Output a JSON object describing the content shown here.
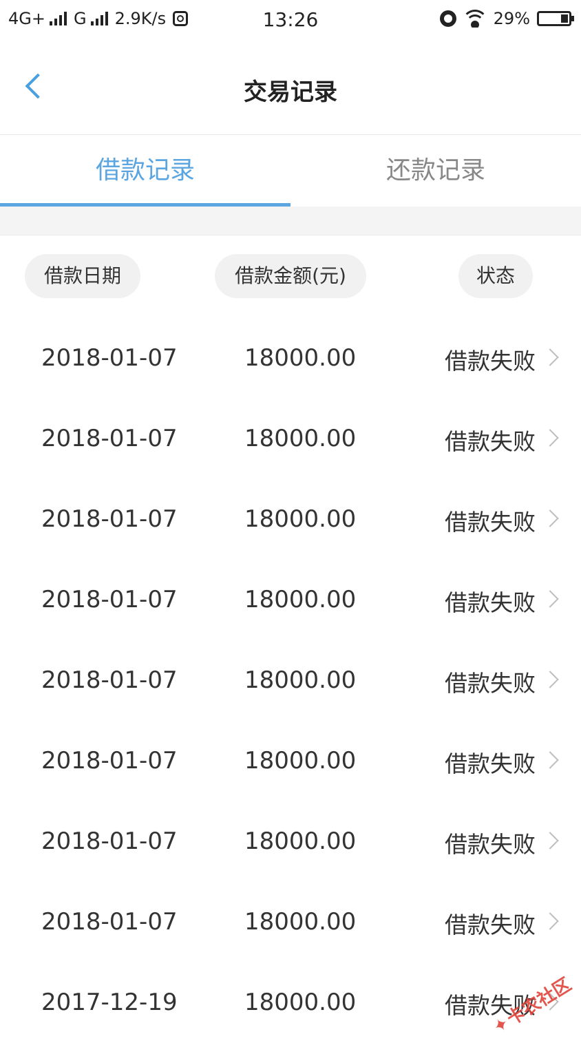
{
  "status_bar": {
    "network1": "4G+",
    "network2": "G",
    "speed": "2.9K/s",
    "time": "13:26",
    "battery": "29%"
  },
  "nav": {
    "title": "交易记录"
  },
  "tabs": [
    {
      "label": "借款记录",
      "active": true
    },
    {
      "label": "还款记录",
      "active": false
    }
  ],
  "table": {
    "headers": {
      "date": "借款日期",
      "amount": "借款金额(元)",
      "status": "状态"
    },
    "rows": [
      {
        "date": "2018-01-07",
        "amount": "18000.00",
        "status": "借款失败"
      },
      {
        "date": "2018-01-07",
        "amount": "18000.00",
        "status": "借款失败"
      },
      {
        "date": "2018-01-07",
        "amount": "18000.00",
        "status": "借款失败"
      },
      {
        "date": "2018-01-07",
        "amount": "18000.00",
        "status": "借款失败"
      },
      {
        "date": "2018-01-07",
        "amount": "18000.00",
        "status": "借款失败"
      },
      {
        "date": "2018-01-07",
        "amount": "18000.00",
        "status": "借款失败"
      },
      {
        "date": "2018-01-07",
        "amount": "18000.00",
        "status": "借款失败"
      },
      {
        "date": "2018-01-07",
        "amount": "18000.00",
        "status": "借款失败"
      },
      {
        "date": "2017-12-19",
        "amount": "18000.00",
        "status": "借款失败"
      }
    ]
  },
  "watermark": {
    "text": "卡农社区"
  },
  "colors": {
    "accent": "#5ba6e0",
    "back_icon": "#4a9fe0",
    "text": "#333333",
    "muted": "#888888"
  }
}
